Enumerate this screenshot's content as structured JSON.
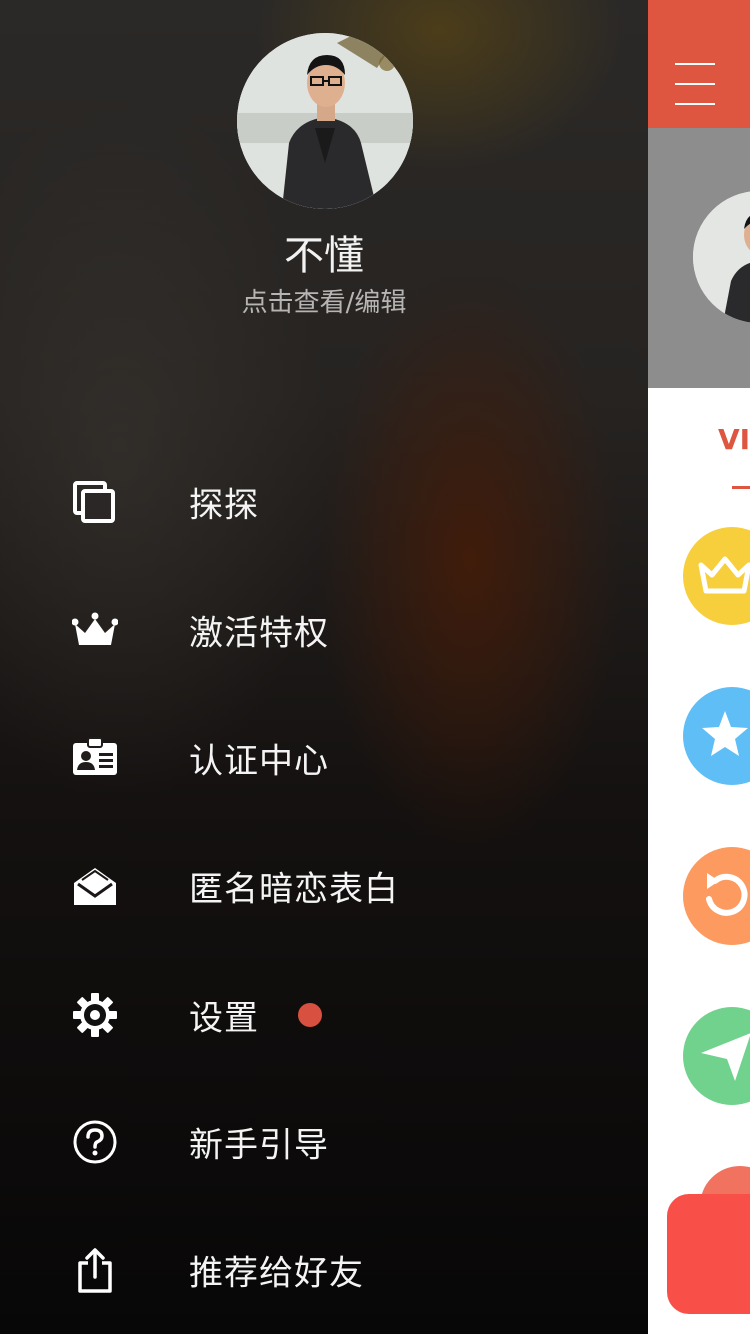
{
  "profile": {
    "name": "不懂",
    "subtitle": "点击查看/编辑"
  },
  "menu": {
    "items": [
      {
        "label": "探探",
        "icon": "cards-icon"
      },
      {
        "label": "激活特权",
        "icon": "crown-icon"
      },
      {
        "label": "认证中心",
        "icon": "id-card-icon"
      },
      {
        "label": "匿名暗恋表白",
        "icon": "open-envelope-icon"
      },
      {
        "label": "设置",
        "icon": "gear-icon",
        "badge": true
      },
      {
        "label": "新手引导",
        "icon": "help-circle-icon"
      },
      {
        "label": "推荐给好友",
        "icon": "share-icon"
      }
    ]
  },
  "main": {
    "tab_label": "VIP",
    "feature_icons": [
      {
        "icon": "crown-icon",
        "color": "#f7cf3c"
      },
      {
        "icon": "star-icon",
        "color": "#5fbef5"
      },
      {
        "icon": "rewind-icon",
        "color": "#fc9a5f"
      },
      {
        "icon": "send-icon",
        "color": "#70d28c"
      }
    ]
  },
  "colors": {
    "accent": "#de5640",
    "badge": "#d8503f",
    "button": "#f85049"
  }
}
